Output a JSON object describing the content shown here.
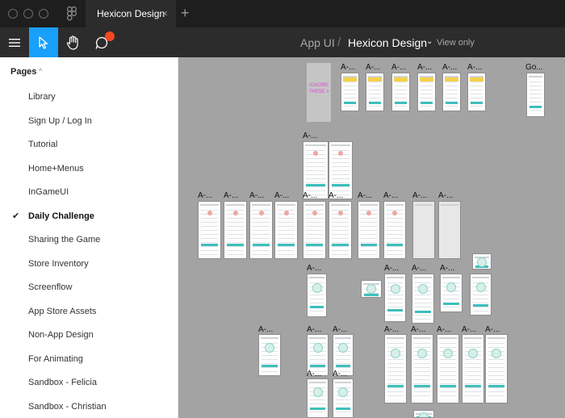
{
  "window": {
    "tab_title": "Hexicon Design",
    "tab_close": "×",
    "new_tab": "+"
  },
  "toolbar": {
    "project": "App UI",
    "separator": "/",
    "file_name": "Hexicon Design",
    "dropdown_glyph": "⌄",
    "mode": "View only"
  },
  "icons": {
    "menu": "hamburger-menu-icon",
    "move": "pointer-arrow-icon",
    "hand": "hand-tool-icon",
    "comment": "comment-bubble-icon",
    "notification_color": "#f24822"
  },
  "colors": {
    "active_tool": "#18a0fb",
    "canvas": "#a3a3a3",
    "accent_teal": "#3dbfbb",
    "ignore_text": "#d94bd0"
  },
  "pages": {
    "header": "Pages",
    "caret": "^",
    "check": "✔",
    "items": [
      {
        "label": "Library"
      },
      {
        "label": "Sign Up / Log In"
      },
      {
        "label": "Tutorial"
      },
      {
        "label": "Home+Menus"
      },
      {
        "label": "InGameUI"
      },
      {
        "label": "Daily Challenge",
        "current": true
      },
      {
        "label": "Sharing the Game"
      },
      {
        "label": "Store Inventory"
      },
      {
        "label": "Screenflow"
      },
      {
        "label": "App Store Assets"
      },
      {
        "label": "Non-App Design"
      },
      {
        "label": "For Animating"
      },
      {
        "label": "Sandbox - Felicia"
      },
      {
        "label": "Sandbox - Christian"
      }
    ]
  },
  "canvas": {
    "ignore_note": "IGNORE THESE >",
    "frame_label": "A-...",
    "frame_label_alt": "Go..."
  }
}
